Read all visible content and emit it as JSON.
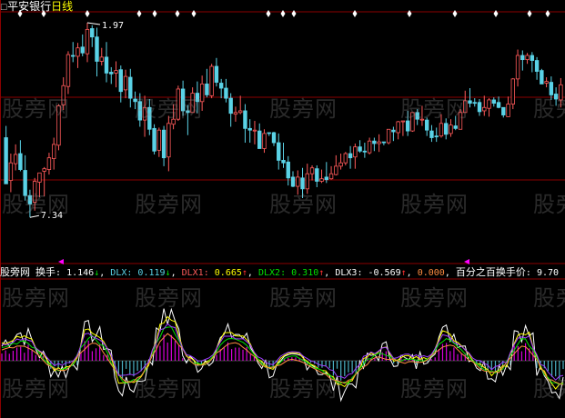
{
  "header": {
    "marker": "☐",
    "stock_name": "平安银行",
    "period": "日线"
  },
  "price_labels": {
    "high": "1.97",
    "low": "7.34"
  },
  "indicator_bar": {
    "source": "股旁网",
    "turnover_label": "换手",
    "turnover_value": "1.146",
    "turnover_arrow": "↓",
    "dlx_label": "DLX",
    "dlx_value": "0.119",
    "dlx_arrow": "↓",
    "dlx1_label": "DLX1",
    "dlx1_value": "0.665",
    "dlx1_arrow": "↑",
    "dlx2_label": "DLX2",
    "dlx2_value": "0.310",
    "dlx2_arrow": "↑",
    "dlx3_label": "DLX3",
    "dlx3_value": "-0.569",
    "dlx3_arrow": "↑",
    "extra_value": "0.000",
    "pct_label": "百分之百换手价",
    "pct_value": "9.70"
  },
  "watermark": "股旁网",
  "colors": {
    "up": "#ff5a5a",
    "down": "#5ad2e6",
    "grid": "#8b0000",
    "white": "#ffffff",
    "yellow": "#ffff00",
    "magenta": "#ff00ff",
    "green": "#00e000",
    "purple": "#a040ff",
    "orange": "#ff8c40"
  },
  "chart_data": {
    "type": "candlestick",
    "candles": [
      [
        150,
        95,
        164,
        100
      ],
      [
        99,
        120,
        131,
        85
      ],
      [
        119,
        130,
        142,
        111
      ],
      [
        131,
        112,
        147,
        110
      ],
      [
        111,
        81,
        129,
        75
      ],
      [
        81,
        71,
        88,
        55
      ],
      [
        73,
        98,
        102,
        63
      ],
      [
        97,
        108,
        108,
        79
      ],
      [
        110,
        113,
        115,
        80
      ],
      [
        112,
        126,
        132,
        106
      ],
      [
        125,
        142,
        150,
        112
      ],
      [
        141,
        188,
        190,
        135
      ],
      [
        189,
        212,
        222,
        183
      ],
      [
        211,
        249,
        253,
        202
      ],
      [
        248,
        247,
        264,
        240
      ],
      [
        247,
        257,
        263,
        233
      ],
      [
        258,
        251,
        273,
        247
      ],
      [
        250,
        279,
        287,
        240
      ],
      [
        280,
        270,
        284,
        258
      ],
      [
        270,
        241,
        281,
        223
      ],
      [
        241,
        246,
        257,
        236
      ],
      [
        246,
        227,
        264,
        216
      ],
      [
        228,
        226,
        234,
        214
      ],
      [
        227,
        230,
        241,
        210
      ],
      [
        231,
        205,
        236,
        192
      ],
      [
        207,
        223,
        231,
        197
      ],
      [
        222,
        197,
        232,
        186
      ],
      [
        196,
        193,
        205,
        184
      ],
      [
        193,
        171,
        203,
        163
      ],
      [
        171,
        186,
        200,
        151
      ],
      [
        186,
        160,
        196,
        153
      ],
      [
        161,
        134,
        166,
        130
      ],
      [
        135,
        159,
        162,
        127
      ],
      [
        159,
        126,
        164,
        116
      ],
      [
        127,
        167,
        176,
        110
      ],
      [
        166,
        172,
        190,
        160
      ],
      [
        172,
        208,
        212,
        170
      ],
      [
        208,
        182,
        218,
        176
      ],
      [
        182,
        180,
        189,
        153
      ],
      [
        180,
        203,
        210,
        180
      ],
      [
        203,
        193,
        217,
        179
      ],
      [
        193,
        214,
        224,
        182
      ],
      [
        214,
        201,
        232,
        198
      ],
      [
        200,
        235,
        238,
        197
      ],
      [
        235,
        216,
        245,
        211
      ],
      [
        215,
        209,
        220,
        197
      ],
      [
        209,
        197,
        220,
        192
      ],
      [
        197,
        179,
        203,
        163
      ],
      [
        178,
        180,
        187,
        169
      ],
      [
        180,
        182,
        200,
        178
      ],
      [
        182,
        161,
        190,
        144
      ],
      [
        161,
        159,
        172,
        144
      ],
      [
        159,
        159,
        170,
        142
      ],
      [
        158,
        137,
        167,
        137
      ],
      [
        137,
        155,
        160,
        132
      ],
      [
        156,
        155,
        156,
        152
      ],
      [
        156,
        144,
        157,
        140
      ],
      [
        144,
        123,
        155,
        112
      ],
      [
        123,
        120,
        144,
        114
      ],
      [
        121,
        102,
        128,
        93
      ],
      [
        103,
        92,
        110,
        91
      ],
      [
        92,
        103,
        111,
        82
      ],
      [
        102,
        89,
        114,
        78
      ],
      [
        89,
        107,
        119,
        83
      ],
      [
        107,
        114,
        117,
        99
      ],
      [
        113,
        98,
        117,
        91
      ],
      [
        98,
        101,
        112,
        96
      ],
      [
        103,
        100,
        121,
        96
      ],
      [
        101,
        107,
        116,
        100
      ],
      [
        106,
        116,
        129,
        105
      ],
      [
        116,
        120,
        131,
        112
      ],
      [
        120,
        131,
        133,
        117
      ],
      [
        131,
        126,
        140,
        113
      ],
      [
        127,
        139,
        143,
        113
      ],
      [
        139,
        134,
        147,
        132
      ],
      [
        134,
        133,
        144,
        126
      ],
      [
        132,
        146,
        150,
        130
      ],
      [
        146,
        143,
        150,
        134
      ],
      [
        143,
        145,
        154,
        133
      ],
      [
        145,
        144,
        145,
        141
      ],
      [
        144,
        160,
        160,
        142
      ],
      [
        159,
        157,
        163,
        146
      ],
      [
        156,
        169,
        170,
        148
      ],
      [
        169,
        170,
        170,
        152
      ],
      [
        170,
        158,
        182,
        152
      ],
      [
        158,
        180,
        180,
        157
      ],
      [
        180,
        172,
        184,
        165
      ],
      [
        171,
        172,
        188,
        164
      ],
      [
        171,
        159,
        174,
        152
      ],
      [
        158,
        150,
        165,
        145
      ],
      [
        152,
        151,
        162,
        145
      ],
      [
        152,
        167,
        178,
        150
      ],
      [
        167,
        154,
        173,
        148
      ],
      [
        155,
        165,
        172,
        151
      ],
      [
        164,
        161,
        176,
        159
      ],
      [
        160,
        180,
        184,
        160
      ],
      [
        180,
        194,
        206,
        180
      ],
      [
        194,
        191,
        209,
        186
      ],
      [
        192,
        191,
        197,
        187
      ],
      [
        192,
        181,
        196,
        176
      ],
      [
        182,
        186,
        200,
        176
      ],
      [
        185,
        195,
        197,
        175
      ],
      [
        195,
        191,
        198,
        187
      ],
      [
        192,
        186,
        199,
        185
      ],
      [
        186,
        177,
        183,
        174
      ],
      [
        175,
        190,
        199,
        175
      ],
      [
        190,
        220,
        221,
        184
      ],
      [
        220,
        248,
        255,
        211
      ],
      [
        248,
        243,
        254,
        230
      ],
      [
        243,
        248,
        251,
        238
      ],
      [
        248,
        242,
        252,
        228
      ],
      [
        242,
        229,
        246,
        219
      ],
      [
        230,
        214,
        232,
        214
      ],
      [
        215,
        217,
        222,
        210
      ],
      [
        216,
        201,
        223,
        195
      ],
      [
        202,
        196,
        210,
        188
      ],
      [
        195,
        213,
        221,
        186
      ]
    ],
    "plot_ymin": 0,
    "plot_ymax": 300,
    "high_marker": "1.97",
    "low_marker": "7.34",
    "indicator": {
      "turnover": 1.146,
      "DLX": 0.119,
      "DLX1": 0.665,
      "DLX2": 0.31,
      "DLX3": -0.569,
      "extra": 0.0,
      "full_turnover_price": 9.7
    }
  }
}
